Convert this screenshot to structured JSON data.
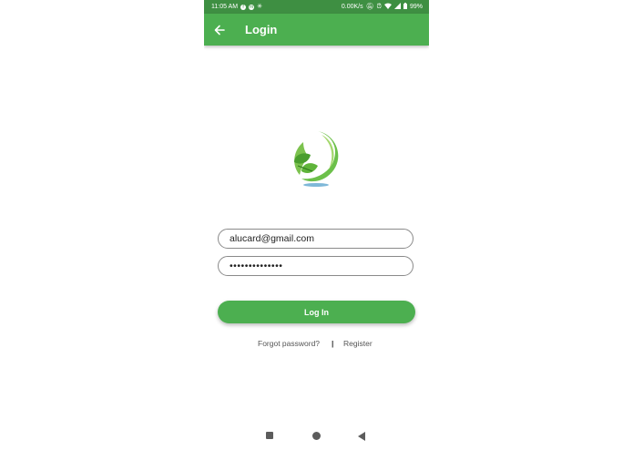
{
  "status_bar": {
    "time": "11:05 AM",
    "network_speed": "0.00K/s",
    "battery": "99%",
    "icons": [
      "facebook-icon",
      "messenger-icon",
      "settings-icon",
      "mute-icon",
      "alarm-icon",
      "wifi-icon",
      "signal-icon",
      "battery-icon"
    ]
  },
  "app_bar": {
    "title": "Login",
    "back_icon": "arrow-left-icon"
  },
  "logo": {
    "icon": "leaf-swirl-logo"
  },
  "form": {
    "email_value": "alucard@gmail.com",
    "password_value": "••••••••••••••",
    "login_label": "Log In"
  },
  "links": {
    "forgot_label": "Forgot password?",
    "divider": "|",
    "register_label": "Register"
  },
  "nav_bar": {
    "icons": [
      "recents-square-icon",
      "home-circle-icon",
      "back-triangle-icon"
    ]
  },
  "colors": {
    "status_bar": "#3e8f42",
    "primary": "#4caf50",
    "text": "#222222",
    "link": "#555555"
  }
}
